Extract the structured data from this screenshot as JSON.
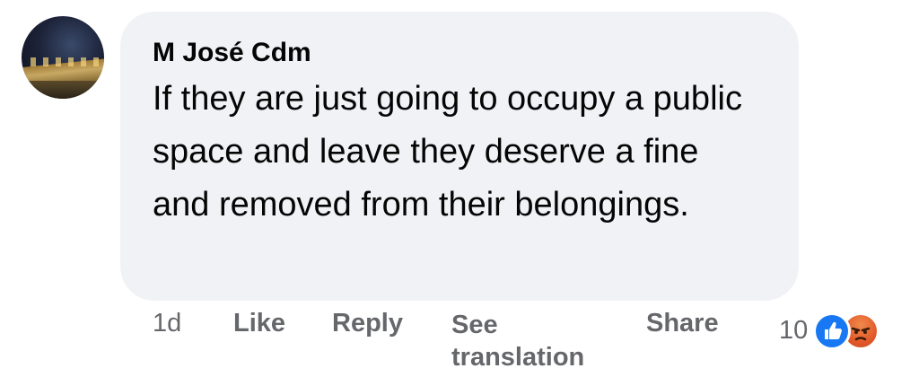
{
  "comment": {
    "author": "M José Cdm",
    "text": "If they are just going to occupy a public space and leave they deserve a fine and removed from their belongings."
  },
  "actions": {
    "time": "1d",
    "like_label": "Like",
    "reply_label": "Reply",
    "see_translation_label": "See translation",
    "share_label": "Share"
  },
  "reactions": {
    "count": "10",
    "icons": [
      "like-icon",
      "angry-icon"
    ],
    "colors": {
      "like": "#1877f2",
      "angry": "#e35a2b"
    }
  }
}
